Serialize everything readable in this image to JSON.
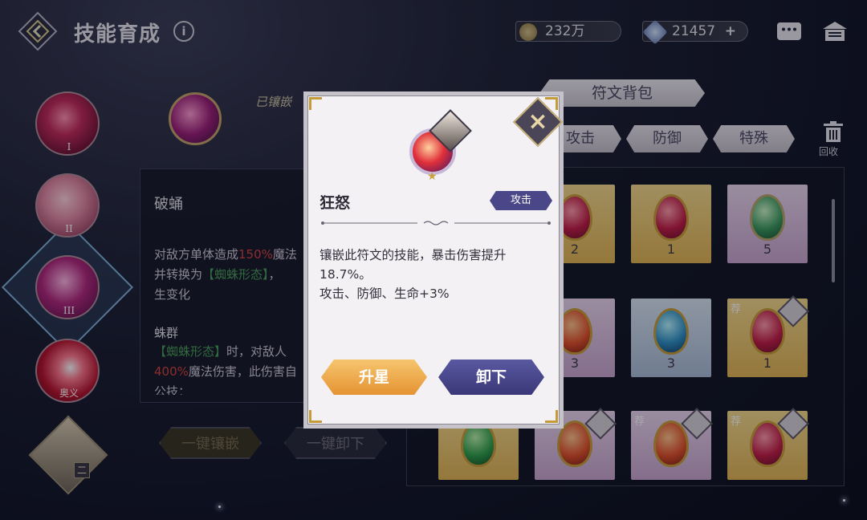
{
  "header": {
    "title": "技能育成",
    "info": "i"
  },
  "currency": {
    "gold": "232万",
    "gems": "21457",
    "gems_plus": "+"
  },
  "skills": [
    {
      "label": "I"
    },
    {
      "label": "II"
    },
    {
      "label": "III"
    },
    {
      "label": "奥义"
    }
  ],
  "hero": {
    "badge": "二"
  },
  "skill_panel": {
    "embed_label": "已镶嵌",
    "name": "破蛹",
    "desc_a": "对敌方单体造成",
    "desc_pct": "150%",
    "desc_b": "魔法",
    "desc_c": "并转换为",
    "desc_form": "【蜘蛛形态】",
    "desc_d": "，",
    "desc_e": "生变化",
    "sub_title": "蛛群",
    "sub_form": "【蜘蛛形态】",
    "sub_a": "时，对敌人",
    "sub_pct": "400%",
    "sub_b": "魔法伤害，此伤害自",
    "sub_c": "公技："
  },
  "actions": {
    "embed_all": "一键镶嵌",
    "unembed_all": "一键卸下"
  },
  "inventory": {
    "title": "符文背包",
    "tabs": [
      "攻击",
      "防御",
      "特殊"
    ],
    "recycle": "回收",
    "recommend": "荐",
    "rows": [
      [
        {
          "count": "2"
        },
        {
          "count": "1"
        },
        {
          "count": "5"
        }
      ],
      [
        {
          "count": "3"
        },
        {
          "count": "3"
        },
        {
          "count": "1"
        }
      ]
    ]
  },
  "modal": {
    "rune_name": "狂怒",
    "tag": "攻击",
    "desc_line1": "镶嵌此符文的技能，暴击伤害提升",
    "desc_line2": "18.7%。",
    "desc_line3": "攻击、防御、生命+3%",
    "btn_upgrade": "升星",
    "btn_remove": "卸下"
  }
}
